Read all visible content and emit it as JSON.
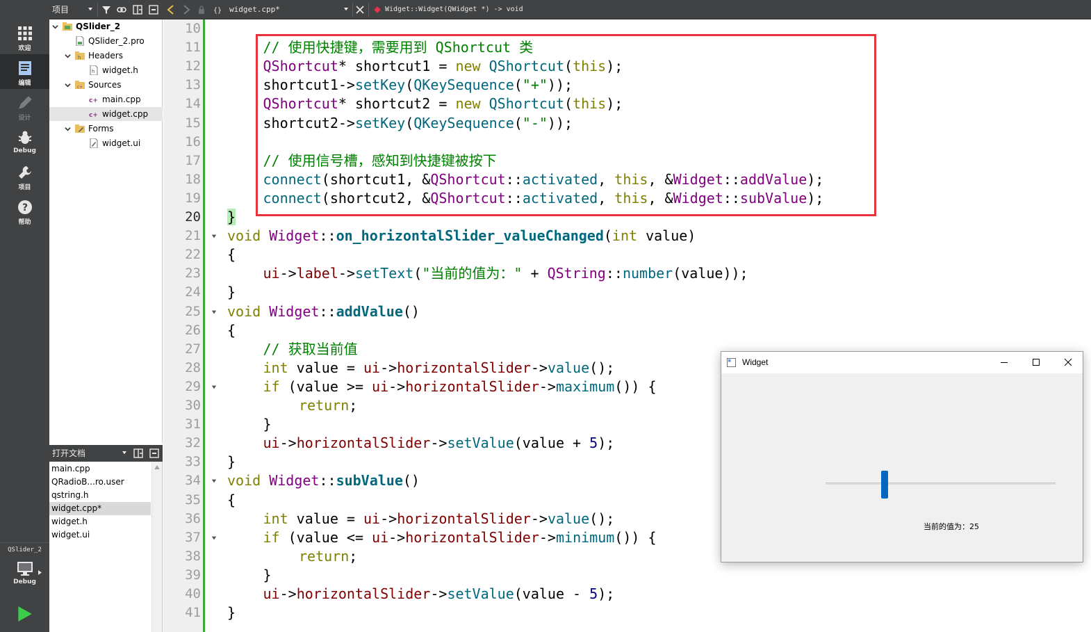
{
  "modes": [
    {
      "id": "welcome",
      "label": "欢迎",
      "icon": "grid-icon",
      "state": "normal"
    },
    {
      "id": "edit",
      "label": "编辑",
      "icon": "document-icon",
      "state": "active"
    },
    {
      "id": "design",
      "label": "设计",
      "icon": "pencil-icon",
      "state": "disabled"
    },
    {
      "id": "debug",
      "label": "Debug",
      "icon": "bug-icon",
      "state": "normal"
    },
    {
      "id": "projects",
      "label": "项目",
      "icon": "wrench-icon",
      "state": "normal"
    },
    {
      "id": "help",
      "label": "帮助",
      "icon": "help-icon",
      "state": "normal"
    }
  ],
  "kit": {
    "project": "QSlider_2",
    "mode_label": "Debug",
    "icon": "monitor-icon"
  },
  "run": {
    "icon": "play-icon",
    "color": "#3ccb4b"
  },
  "toolbar": {
    "panel_title": "项目",
    "file_tab": "widget.cpp*",
    "function_selector": "Widget::Widget(QWidget *) -> void",
    "function_icon_color": "#e8324c"
  },
  "project_tree": [
    {
      "label": "QSlider_2",
      "icon": "project-folder-icon",
      "bold": true,
      "expanded": true,
      "level": 0,
      "selected": false
    },
    {
      "label": "QSlider_2.pro",
      "icon": "pro-file-icon",
      "bold": false,
      "expanded": null,
      "level": 1,
      "selected": false
    },
    {
      "label": "Headers",
      "icon": "headers-folder-icon",
      "bold": false,
      "expanded": true,
      "level": 1,
      "selected": false
    },
    {
      "label": "widget.h",
      "icon": "header-file-icon",
      "bold": false,
      "expanded": null,
      "level": 2,
      "selected": false
    },
    {
      "label": "Sources",
      "icon": "sources-folder-icon",
      "bold": false,
      "expanded": true,
      "level": 1,
      "selected": false
    },
    {
      "label": "main.cpp",
      "icon": "cpp-file-icon",
      "bold": false,
      "expanded": null,
      "level": 2,
      "selected": false
    },
    {
      "label": "widget.cpp",
      "icon": "cpp-file-icon",
      "bold": false,
      "expanded": null,
      "level": 2,
      "selected": true
    },
    {
      "label": "Forms",
      "icon": "forms-folder-icon",
      "bold": false,
      "expanded": true,
      "level": 1,
      "selected": false
    },
    {
      "label": "widget.ui",
      "icon": "ui-file-icon",
      "bold": false,
      "expanded": null,
      "level": 2,
      "selected": false
    }
  ],
  "open_docs": {
    "title": "打开文档",
    "items": [
      {
        "label": "main.cpp",
        "selected": false
      },
      {
        "label": "QRadioB...ro.user",
        "selected": false
      },
      {
        "label": "qstring.h",
        "selected": false
      },
      {
        "label": "widget.cpp*",
        "selected": true
      },
      {
        "label": "widget.h",
        "selected": false
      },
      {
        "label": "widget.ui",
        "selected": false
      }
    ]
  },
  "code": {
    "current_line": 20,
    "lines": [
      {
        "n": 10,
        "fold": false,
        "indent": 1,
        "spans": []
      },
      {
        "n": 11,
        "fold": false,
        "indent": 1,
        "spans": [
          [
            "cm",
            "// 使用快捷键，需要用到 QShortcut 类"
          ]
        ]
      },
      {
        "n": 12,
        "fold": false,
        "indent": 1,
        "spans": [
          [
            "ty",
            "QShortcut"
          ],
          [
            "",
            "* "
          ],
          [
            "",
            "shortcut1 = "
          ],
          [
            "kw",
            "new"
          ],
          [
            "",
            " "
          ],
          [
            "fn",
            "QShortcut"
          ],
          [
            "",
            "("
          ],
          [
            "kw",
            "this"
          ],
          [
            "",
            ");"
          ]
        ]
      },
      {
        "n": 13,
        "fold": false,
        "indent": 1,
        "spans": [
          [
            "",
            "shortcut1->"
          ],
          [
            "fn",
            "setKey"
          ],
          [
            "",
            "("
          ],
          [
            "fn",
            "QKeySequence"
          ],
          [
            "",
            "("
          ],
          [
            "st",
            "\"+\""
          ],
          [
            "",
            "));"
          ]
        ]
      },
      {
        "n": 14,
        "fold": false,
        "indent": 1,
        "spans": [
          [
            "ty",
            "QShortcut"
          ],
          [
            "",
            "* "
          ],
          [
            "",
            "shortcut2 = "
          ],
          [
            "kw",
            "new"
          ],
          [
            "",
            " "
          ],
          [
            "fn",
            "QShortcut"
          ],
          [
            "",
            "("
          ],
          [
            "kw",
            "this"
          ],
          [
            "",
            ");"
          ]
        ]
      },
      {
        "n": 15,
        "fold": false,
        "indent": 1,
        "spans": [
          [
            "",
            "shortcut2->"
          ],
          [
            "fn",
            "setKey"
          ],
          [
            "",
            "("
          ],
          [
            "fn",
            "QKeySequence"
          ],
          [
            "",
            "("
          ],
          [
            "st",
            "\"-\""
          ],
          [
            "",
            "));"
          ]
        ]
      },
      {
        "n": 16,
        "fold": false,
        "indent": 1,
        "spans": []
      },
      {
        "n": 17,
        "fold": false,
        "indent": 1,
        "spans": [
          [
            "cm",
            "// 使用信号槽，感知到快捷键被按下"
          ]
        ]
      },
      {
        "n": 18,
        "fold": false,
        "indent": 1,
        "spans": [
          [
            "fn",
            "connect"
          ],
          [
            "",
            "(shortcut1, &"
          ],
          [
            "ty",
            "QShortcut"
          ],
          [
            "",
            "::"
          ],
          [
            "fn",
            "activated"
          ],
          [
            "",
            ", "
          ],
          [
            "kw",
            "this"
          ],
          [
            "",
            ", &"
          ],
          [
            "ty",
            "Widget"
          ],
          [
            "",
            "::"
          ],
          [
            "ty",
            "addValue"
          ],
          [
            "",
            ");"
          ]
        ]
      },
      {
        "n": 19,
        "fold": false,
        "indent": 1,
        "spans": [
          [
            "fn",
            "connect"
          ],
          [
            "",
            "(shortcut2, &"
          ],
          [
            "ty",
            "QShortcut"
          ],
          [
            "",
            "::"
          ],
          [
            "fn",
            "activated"
          ],
          [
            "",
            ", "
          ],
          [
            "kw",
            "this"
          ],
          [
            "",
            ", &"
          ],
          [
            "ty",
            "Widget"
          ],
          [
            "",
            "::"
          ],
          [
            "ty",
            "subValue"
          ],
          [
            "",
            ");"
          ]
        ]
      },
      {
        "n": 20,
        "fold": false,
        "indent": 0,
        "spans": [
          [
            "brace-hl",
            "}"
          ]
        ]
      },
      {
        "n": 21,
        "fold": true,
        "indent": 0,
        "spans": [
          [
            "kw",
            "void"
          ],
          [
            "",
            " "
          ],
          [
            "ty",
            "Widget"
          ],
          [
            "",
            "::"
          ],
          [
            "fnd",
            "on_horizontalSlider_valueChanged"
          ],
          [
            "",
            "("
          ],
          [
            "kw",
            "int"
          ],
          [
            "",
            " value)"
          ]
        ]
      },
      {
        "n": 22,
        "fold": false,
        "indent": 0,
        "spans": [
          [
            "",
            "{"
          ]
        ]
      },
      {
        "n": 23,
        "fold": false,
        "indent": 1,
        "spans": [
          [
            "mem",
            "ui"
          ],
          [
            "",
            "->"
          ],
          [
            "mem",
            "label"
          ],
          [
            "",
            "->"
          ],
          [
            "fn",
            "setText"
          ],
          [
            "",
            "("
          ],
          [
            "st",
            "\"当前的值为：\""
          ],
          [
            "",
            " + "
          ],
          [
            "ty",
            "QString"
          ],
          [
            "",
            "::"
          ],
          [
            "fn",
            "number"
          ],
          [
            "",
            "(value));"
          ]
        ]
      },
      {
        "n": 24,
        "fold": false,
        "indent": 0,
        "spans": [
          [
            "",
            "}"
          ]
        ]
      },
      {
        "n": 25,
        "fold": true,
        "indent": 0,
        "spans": [
          [
            "kw",
            "void"
          ],
          [
            "",
            " "
          ],
          [
            "ty",
            "Widget"
          ],
          [
            "",
            "::"
          ],
          [
            "fnd",
            "addValue"
          ],
          [
            "",
            "()"
          ]
        ]
      },
      {
        "n": 26,
        "fold": false,
        "indent": 0,
        "spans": [
          [
            "",
            "{"
          ]
        ]
      },
      {
        "n": 27,
        "fold": false,
        "indent": 1,
        "spans": [
          [
            "cm",
            "// 获取当前值"
          ]
        ]
      },
      {
        "n": 28,
        "fold": false,
        "indent": 1,
        "spans": [
          [
            "kw",
            "int"
          ],
          [
            "",
            " value = "
          ],
          [
            "mem",
            "ui"
          ],
          [
            "",
            "->"
          ],
          [
            "mem",
            "horizontalSlider"
          ],
          [
            "",
            "->"
          ],
          [
            "fn",
            "value"
          ],
          [
            "",
            "();"
          ]
        ]
      },
      {
        "n": 29,
        "fold": true,
        "indent": 1,
        "spans": [
          [
            "kw",
            "if"
          ],
          [
            "",
            " (value >= "
          ],
          [
            "mem",
            "ui"
          ],
          [
            "",
            "->"
          ],
          [
            "mem",
            "horizontalSlider"
          ],
          [
            "",
            "->"
          ],
          [
            "fn",
            "maximum"
          ],
          [
            "",
            "()) {"
          ]
        ]
      },
      {
        "n": 30,
        "fold": false,
        "indent": 2,
        "spans": [
          [
            "kw",
            "return"
          ],
          [
            "",
            ";"
          ]
        ]
      },
      {
        "n": 31,
        "fold": false,
        "indent": 1,
        "spans": [
          [
            "",
            "}"
          ]
        ]
      },
      {
        "n": 32,
        "fold": false,
        "indent": 1,
        "spans": [
          [
            "mem",
            "ui"
          ],
          [
            "",
            "->"
          ],
          [
            "mem",
            "horizontalSlider"
          ],
          [
            "",
            "->"
          ],
          [
            "fn",
            "setValue"
          ],
          [
            "",
            "(value + "
          ],
          [
            "nm",
            "5"
          ],
          [
            "",
            ");"
          ]
        ]
      },
      {
        "n": 33,
        "fold": false,
        "indent": 0,
        "spans": [
          [
            "",
            "}"
          ]
        ]
      },
      {
        "n": 34,
        "fold": true,
        "indent": 0,
        "spans": [
          [
            "kw",
            "void"
          ],
          [
            "",
            " "
          ],
          [
            "ty",
            "Widget"
          ],
          [
            "",
            "::"
          ],
          [
            "fnd",
            "subValue"
          ],
          [
            "",
            "()"
          ]
        ]
      },
      {
        "n": 35,
        "fold": false,
        "indent": 0,
        "spans": [
          [
            "",
            "{"
          ]
        ]
      },
      {
        "n": 36,
        "fold": false,
        "indent": 1,
        "spans": [
          [
            "kw",
            "int"
          ],
          [
            "",
            " value = "
          ],
          [
            "mem",
            "ui"
          ],
          [
            "",
            "->"
          ],
          [
            "mem",
            "horizontalSlider"
          ],
          [
            "",
            "->"
          ],
          [
            "fn",
            "value"
          ],
          [
            "",
            "();"
          ]
        ]
      },
      {
        "n": 37,
        "fold": true,
        "indent": 1,
        "spans": [
          [
            "kw",
            "if"
          ],
          [
            "",
            " (value <= "
          ],
          [
            "mem",
            "ui"
          ],
          [
            "",
            "->"
          ],
          [
            "mem",
            "horizontalSlider"
          ],
          [
            "",
            "->"
          ],
          [
            "fn",
            "minimum"
          ],
          [
            "",
            "()) {"
          ]
        ]
      },
      {
        "n": 38,
        "fold": false,
        "indent": 2,
        "spans": [
          [
            "kw",
            "return"
          ],
          [
            "",
            ";"
          ]
        ]
      },
      {
        "n": 39,
        "fold": false,
        "indent": 1,
        "spans": [
          [
            "",
            "}"
          ]
        ]
      },
      {
        "n": 40,
        "fold": false,
        "indent": 1,
        "spans": [
          [
            "mem",
            "ui"
          ],
          [
            "",
            "->"
          ],
          [
            "mem",
            "horizontalSlider"
          ],
          [
            "",
            "->"
          ],
          [
            "fn",
            "setValue"
          ],
          [
            "",
            "(value - "
          ],
          [
            "nm",
            "5"
          ],
          [
            "",
            ");"
          ]
        ]
      },
      {
        "n": 41,
        "fold": false,
        "indent": 0,
        "spans": [
          [
            "",
            "}"
          ]
        ]
      }
    ]
  },
  "widget_window": {
    "title": "Widget",
    "slider": {
      "value": 25,
      "min": 0,
      "max": 100,
      "accent": "#0067c0"
    },
    "value_label": "当前的值为：25"
  },
  "colors": {
    "highlight_box": "#e8323c",
    "sidebar_bg": "#404244",
    "changed_lines": "#3aab3a"
  }
}
